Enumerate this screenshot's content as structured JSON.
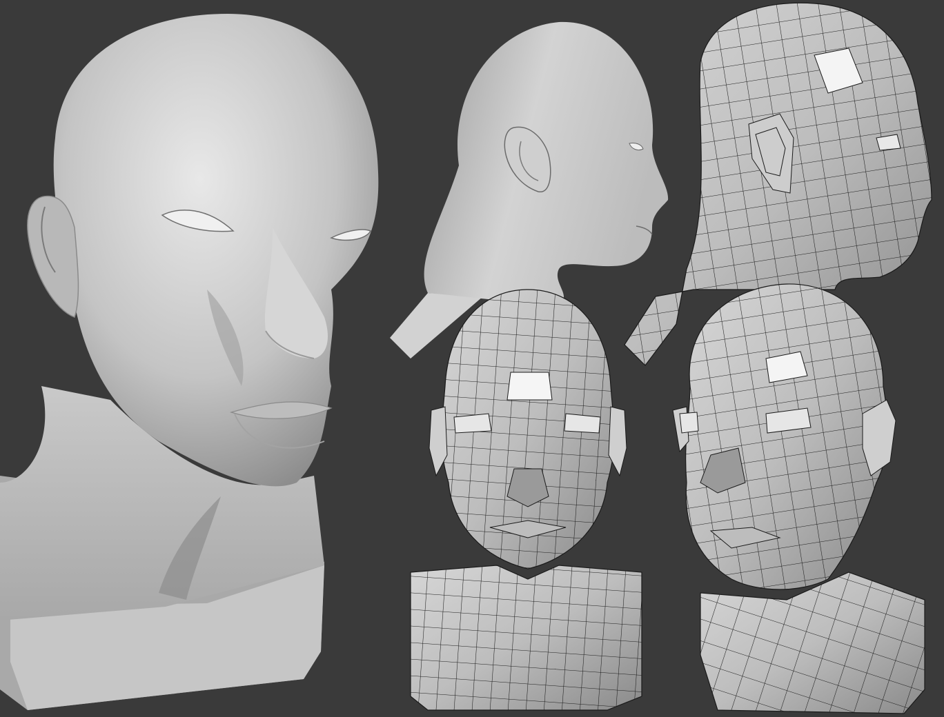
{
  "scene": {
    "background": "#3a3a3a",
    "surface_light": "#e6e6e6",
    "surface_mid": "#b9b9b9",
    "surface_dark": "#6e6e6e",
    "wire": "#1a1a1a"
  }
}
